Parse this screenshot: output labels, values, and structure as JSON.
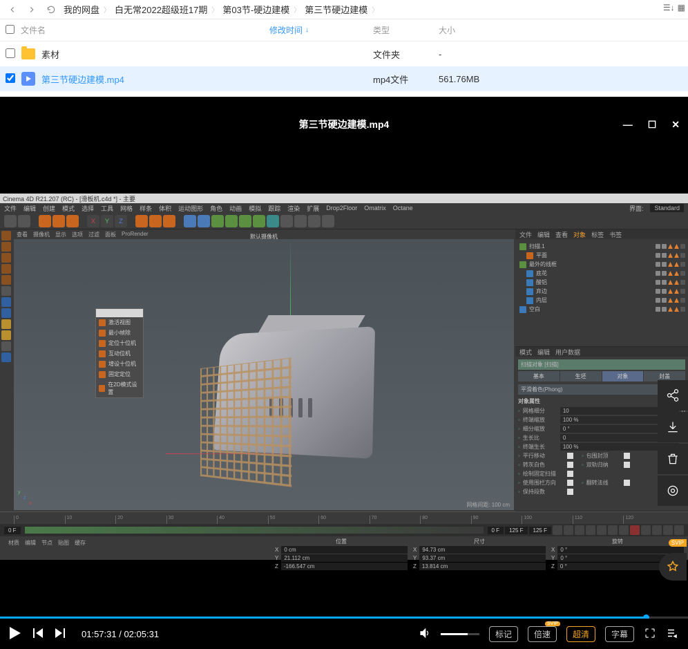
{
  "nav": {
    "breadcrumb": [
      "我的网盘",
      "白无常2022超级班17期",
      "第03节-硬边建模",
      "第三节硬边建模"
    ]
  },
  "file_header": {
    "name": "文件名",
    "time": "修改时间",
    "type": "类型",
    "size": "大小"
  },
  "files": [
    {
      "name": "素材",
      "type": "文件夹",
      "size": "-",
      "selected": false,
      "kind": "folder"
    },
    {
      "name": "第三节硬边建模.mp4",
      "type": "mp4文件",
      "size": "561.76MB",
      "selected": true,
      "kind": "video"
    }
  ],
  "video": {
    "title": "第三节硬边建模.mp4",
    "current": "01:57:31",
    "total": "02:05:31",
    "btn_mark": "标记",
    "btn_speed": "倍速",
    "btn_quality": "超清",
    "btn_subtitle": "字幕",
    "svip": "SVIP"
  },
  "c4d": {
    "title": "Cinema 4D R21.207 (RC) - [滑板机.c4d *] - 主要",
    "menus": [
      "文件",
      "编辑",
      "创建",
      "模式",
      "选择",
      "工具",
      "网格",
      "样条",
      "体积",
      "运动图形",
      "角色",
      "动画",
      "模拟",
      "跟踪",
      "渲染",
      "扩展",
      "Drop2Floor",
      "Omatrix",
      "Octane"
    ],
    "menu_right_label": "界面:",
    "menu_right_val": "Standard",
    "vp_tabs": [
      "查看",
      "摄像机",
      "显示",
      "选项",
      "过滤",
      "面板",
      "ProRender"
    ],
    "vp_cam": "默认摄像机",
    "vp_grid": "网格间距: 100 cm",
    "ctxmenu": [
      "激活视图",
      "最小帧除",
      "定位十位机",
      "互动位机",
      "增设十位机",
      "固定定位",
      "在2D模式设置"
    ],
    "hierarchy_tabs": [
      "文件",
      "编辑",
      "查看",
      "对象",
      "标签",
      "书签"
    ],
    "hierarchy": [
      {
        "name": "扫描.1",
        "indent": 0,
        "icon": "gr"
      },
      {
        "name": "平面",
        "indent": 1,
        "icon": "or"
      },
      {
        "name": "最外的线框",
        "indent": 0,
        "icon": "gr"
      },
      {
        "name": "底花",
        "indent": 1,
        "icon": "bl"
      },
      {
        "name": "酸铝",
        "indent": 1,
        "icon": "bl"
      },
      {
        "name": "弃边",
        "indent": 1,
        "icon": "bl"
      },
      {
        "name": "内层",
        "indent": 1,
        "icon": "bl"
      },
      {
        "name": "空白",
        "indent": 0,
        "icon": "bl"
      }
    ],
    "attr_tabs_top": [
      "模式",
      "编辑",
      "用户数据"
    ],
    "attr_title": "扫描对象 [扫描]",
    "attr_tabs": [
      "基本",
      "生坯",
      "对象",
      "封盖"
    ],
    "attr_group": "平滑着色(Phong)",
    "attr_section": "对象属性",
    "attrs": [
      {
        "label": "网格细分",
        "value": "10"
      },
      {
        "label": "终端缩放",
        "value": "100 %"
      },
      {
        "label": "细分缩放",
        "value": "0 °"
      },
      {
        "label": "生长比",
        "value": "0"
      },
      {
        "label": "终端生长",
        "value": "100 %"
      }
    ],
    "attr_checks": [
      [
        "平行移动",
        "包围封顶"
      ],
      [
        "转灰白色",
        "双轨归纳"
      ],
      [
        "绘制固定扫描",
        ""
      ],
      [
        "使用围栏方向",
        "翻转法线"
      ],
      [
        "保持段数",
        ""
      ]
    ],
    "timeline": {
      "start": "0 F",
      "end": "125 F",
      "current": "0 F",
      "max": "125 F"
    },
    "ticks": [
      "0",
      "10",
      "20",
      "30",
      "40",
      "50",
      "60",
      "70",
      "80",
      "90",
      "100",
      "110",
      "120"
    ],
    "bottom_tabs": [
      "材质",
      "编辑",
      "节点",
      "贴图",
      "缓存"
    ],
    "coords_header": [
      "位置",
      "尺寸",
      "旋转"
    ],
    "coords": [
      {
        "axis": "X",
        "pos": "0 cm",
        "size": "94.73 cm",
        "rot": "0 °"
      },
      {
        "axis": "Y",
        "pos": "21.112 cm",
        "size": "93.37 cm",
        "rot": "0 °"
      },
      {
        "axis": "Z",
        "pos": "-166.547 cm",
        "size": "13.814 cm",
        "rot": "0 °"
      }
    ]
  }
}
